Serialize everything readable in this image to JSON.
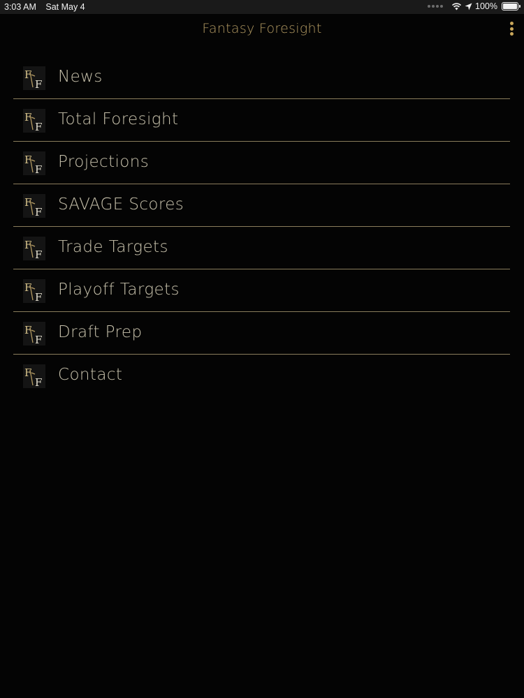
{
  "status_bar": {
    "time": "3:03 AM",
    "date": "Sat May 4",
    "battery": "100%",
    "icons": [
      "wifi-icon",
      "location-arrow-icon",
      "battery-icon"
    ]
  },
  "header": {
    "title": "Fantasy Foresight",
    "menu_icon": "more-vertical-icon"
  },
  "menu": {
    "items": [
      {
        "label": "News"
      },
      {
        "label": "Total Foresight"
      },
      {
        "label": "Projections"
      },
      {
        "label": "SAVAGE Scores"
      },
      {
        "label": "Trade Targets"
      },
      {
        "label": "Playoff Targets"
      },
      {
        "label": "Draft Prep"
      },
      {
        "label": "Contact"
      }
    ]
  },
  "colors": {
    "background": "#040404",
    "accent_gold": "#b39a62",
    "label_text": "#c8c2ac",
    "divider": "#8a7d5c"
  }
}
